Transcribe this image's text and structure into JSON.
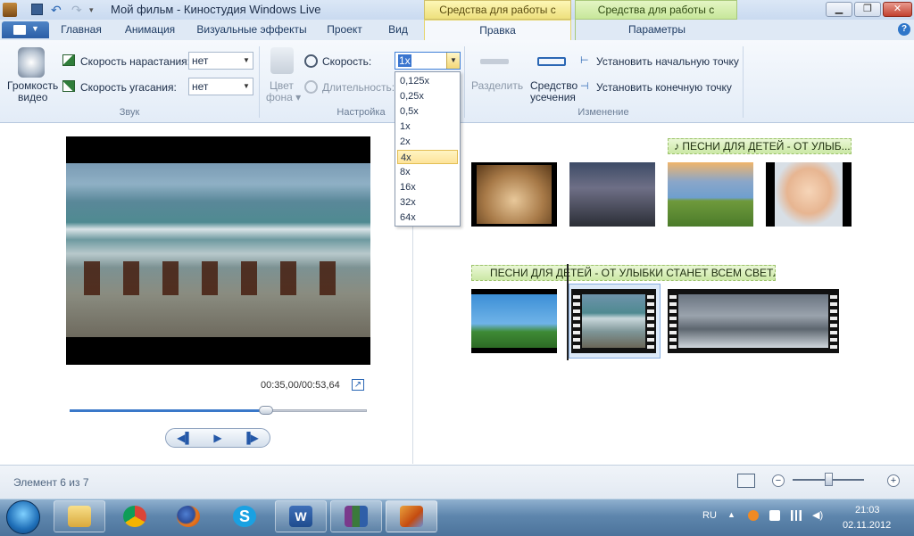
{
  "window": {
    "title": "Мой фильм - Киностудия Windows Live",
    "context_tab_video": "Средства для работы с видео",
    "context_tab_music": "Средства для работы с музыкой",
    "minimize": "▁",
    "maximize": "❐",
    "close": "✕"
  },
  "tabs": [
    "Главная",
    "Анимация",
    "Визуальные эффекты",
    "Проект",
    "Вид",
    "Правка",
    "Параметры"
  ],
  "ribbon": {
    "sound": {
      "volume_label_1": "Громкость",
      "volume_label_2": "видео",
      "fade_in_label": "Скорость нарастания:",
      "fade_in_value": "нет",
      "fade_out_label": "Скорость угасания:",
      "fade_out_value": "нет",
      "group_label": "Звук"
    },
    "adjust": {
      "bg_color_label_1": "Цвет",
      "bg_color_label_2": "фона ▾",
      "speed_label": "Скорость:",
      "speed_value": "1x",
      "duration_label": "Длительность:",
      "group_label": "Настройка"
    },
    "edit": {
      "split_label": "Разделить",
      "trim_label_1": "Средство",
      "trim_label_2": "усечения",
      "set_start": "Установить начальную точку",
      "set_end": "Установить конечную точку",
      "group_label": "Изменение"
    }
  },
  "speed_options": [
    "0,125x",
    "0,25x",
    "0,5x",
    "1x",
    "2x",
    "4x",
    "8x",
    "16x",
    "32x",
    "64x"
  ],
  "speed_highlighted": "4x",
  "player": {
    "timecode": "00:35,00/00:53,64",
    "progress": 0.66,
    "prev": "◀▌",
    "play": "▶",
    "next": "▐▶"
  },
  "storyboard": {
    "music_track_1": "♪ ПЕСНИ ДЛЯ ДЕТЕЙ - ОТ УЛЫБ...",
    "music_track_2": "ПЕСНИ ДЛЯ ДЕТЕЙ - ОТ УЛЫБКИ СТАНЕТ ВСЕМ СВЕТЛ...",
    "selected_clip": 6,
    "total_clips": 7
  },
  "status": {
    "text": "Элемент 6 из 7",
    "zoom_minus": "−",
    "zoom_plus": "+"
  },
  "taskbar": {
    "lang": "RU",
    "time": "21:03",
    "date": "02.11.2012",
    "apps": [
      "explorer",
      "chrome",
      "firefox",
      "skype",
      "word",
      "winrar",
      "movie-maker"
    ]
  },
  "colors": {
    "accent": "#3a78c9",
    "context_video": "#eee07d",
    "context_music": "#c7e79a"
  }
}
